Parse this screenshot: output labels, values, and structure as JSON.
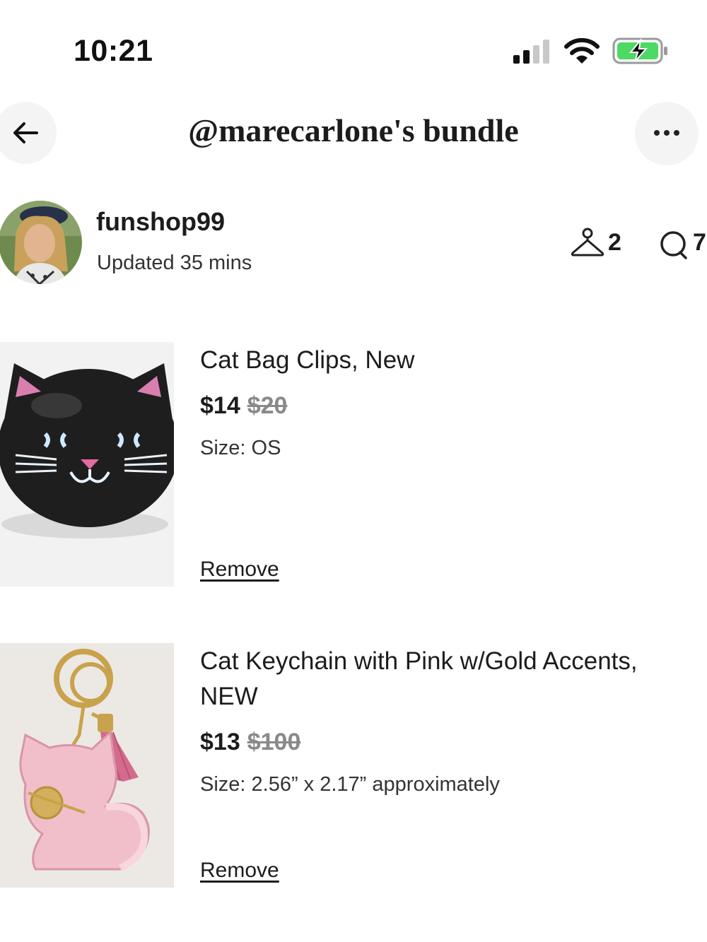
{
  "status_bar": {
    "time": "10:21"
  },
  "header": {
    "title": "@marecarlone's bundle",
    "back_icon": "arrow-left-icon",
    "more_icon": "more-horizontal-icon"
  },
  "seller": {
    "username": "funshop99",
    "updated": "Updated 35 mins",
    "likes_count": "2",
    "comments_count": "7"
  },
  "items": [
    {
      "title": "Cat Bag Clips, New",
      "price": "$14",
      "original_price": "$20",
      "size": "Size: OS",
      "remove_label": "Remove"
    },
    {
      "title": "Cat Keychain with Pink w/Gold Accents, NEW",
      "price": "$13",
      "original_price": "$100",
      "size": "Size: 2.56” x 2.17” approximately",
      "remove_label": "Remove"
    }
  ],
  "colors": {
    "text": "#1c1c1c",
    "muted": "#8a8a8a",
    "button_bg": "#f4f4f4",
    "battery_green": "#4cd964"
  }
}
